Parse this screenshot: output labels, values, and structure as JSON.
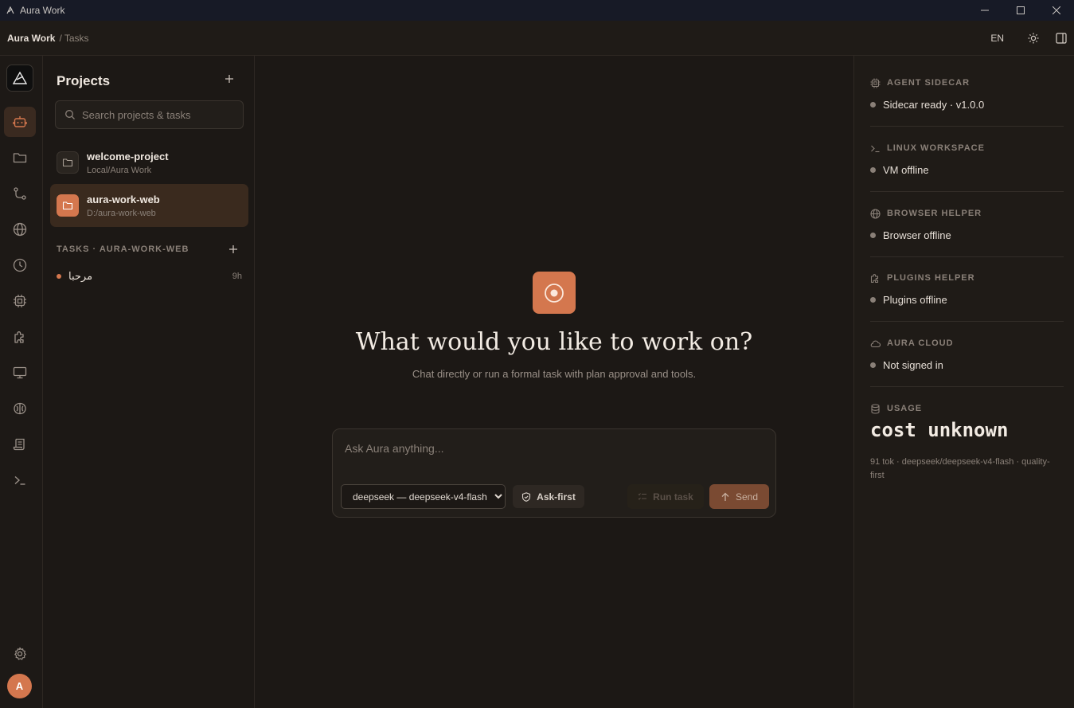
{
  "window": {
    "title": "Aura Work"
  },
  "breadcrumb": {
    "app": "Aura Work",
    "separator": "/",
    "page": "Tasks"
  },
  "topbar": {
    "language": "EN"
  },
  "projects": {
    "title": "Projects",
    "search_placeholder": "Search projects & tasks",
    "items": [
      {
        "name": "welcome-project",
        "path": "Local/Aura Work"
      },
      {
        "name": "aura-work-web",
        "path": "D:/aura-work-web"
      }
    ],
    "tasks_header": "TASKS · AURA-WORK-WEB",
    "tasks": [
      {
        "name": "مرحبا",
        "age": "9h"
      }
    ]
  },
  "main": {
    "title": "What would you like to work on?",
    "subtitle": "Chat directly or run a formal task with plan approval and tools.",
    "composer_placeholder": "Ask Aura anything...",
    "model_selected": "deepseek — deepseek-v4-flash",
    "ask_first_label": "Ask-first",
    "run_task_label": "Run task",
    "send_label": "Send"
  },
  "sidecar": {
    "agent": {
      "title": "AGENT SIDECAR",
      "value": "Sidecar ready · v1.0.0"
    },
    "linux": {
      "title": "LINUX WORKSPACE",
      "value": "VM offline"
    },
    "browser": {
      "title": "BROWSER HELPER",
      "value": "Browser offline"
    },
    "plugins": {
      "title": "PLUGINS HELPER",
      "value": "Plugins offline"
    },
    "cloud": {
      "title": "AURA CLOUD",
      "value": "Not signed in"
    },
    "usage": {
      "title": "USAGE",
      "cost": "cost unknown",
      "detail": "91 tok · deepseek/deepseek-v4-flash · quality-first"
    }
  },
  "user": {
    "avatar_letter": "A"
  },
  "colors": {
    "accent": "#d4774e",
    "background": "#1c1815",
    "panel": "#1f1b17",
    "titlebar": "#171a26"
  }
}
